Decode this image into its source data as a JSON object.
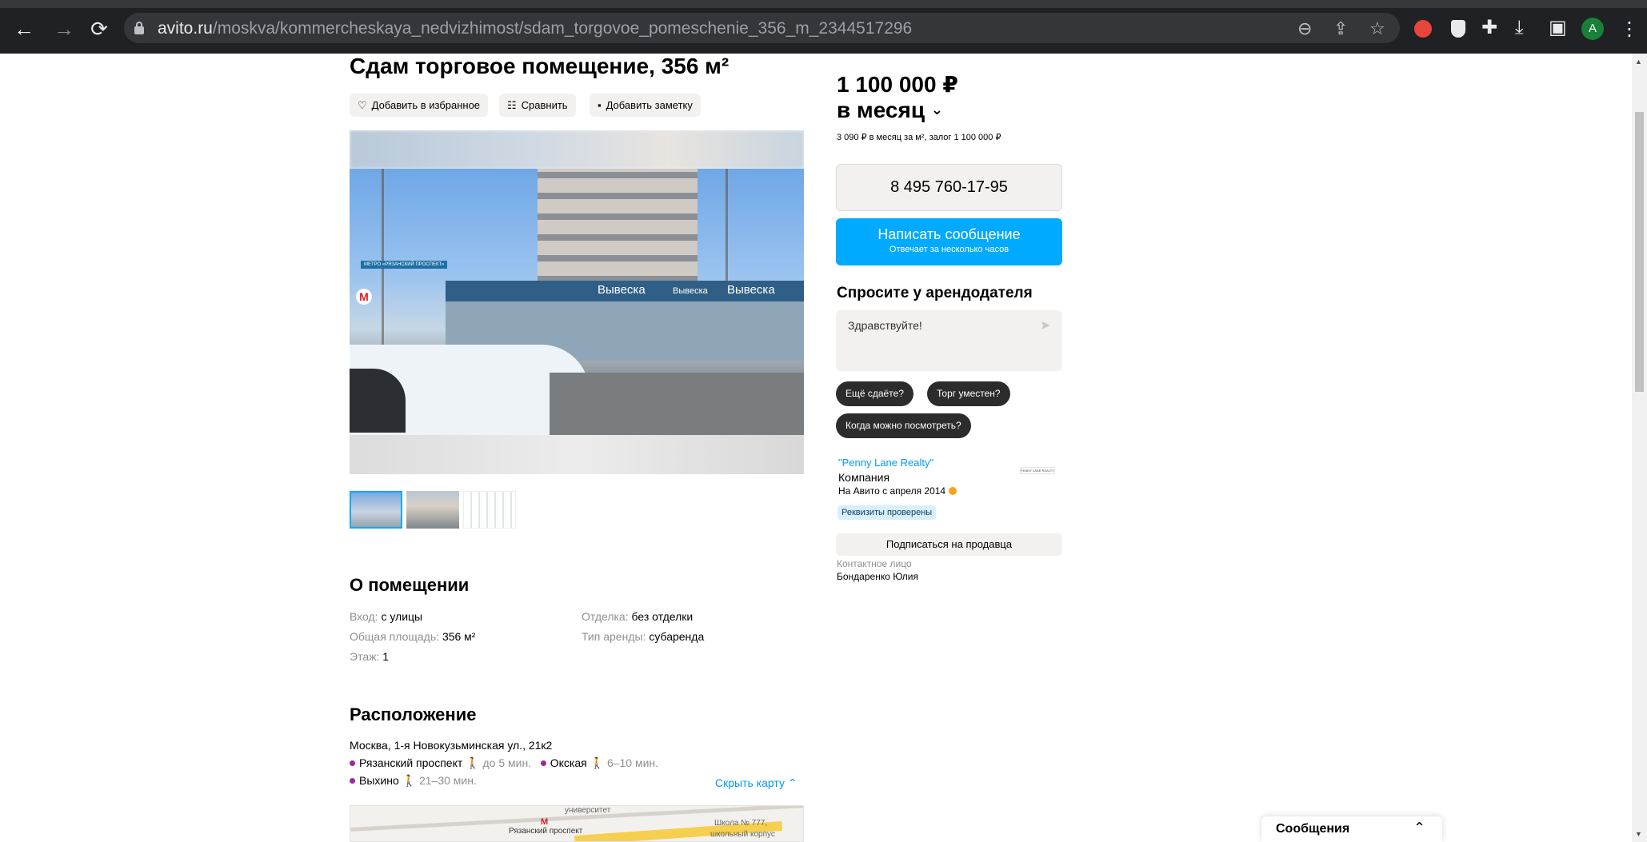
{
  "browser": {
    "url_host": "avito.ru",
    "url_path": "/moskva/kommercheskaya_nedvizhimost/sdam_torgovoe_pomeschenie_356_m_2344517296",
    "profile_initial": "A",
    "back_icon": "←",
    "forward_icon": "→",
    "reload_icon": "⟳",
    "zoom_icon": "⊖",
    "share_icon": "⇪",
    "star_icon": "☆",
    "puzzle_icon": "✚",
    "download_icon": "⤓",
    "sidepanel_icon": "▣",
    "menu_icon": "⋮"
  },
  "listing": {
    "title": "Сдам торговое помещение, 356 м²",
    "actions": {
      "favorite": "Добавить в избранное",
      "compare": "Сравнить",
      "note": "Добавить заметку"
    },
    "photo_labels": {
      "metro": "МЕТРО «РЯЗАНСКИЙ ПРОСПЕКТ»",
      "sign1": "Вывеска",
      "sign2": "Вывеска",
      "sign3": "Вывеска"
    }
  },
  "about": {
    "heading": "О помещении",
    "params": [
      {
        "key": "Вход:",
        "value": "с улицы"
      },
      {
        "key": "Общая площадь:",
        "value": "356 м²"
      },
      {
        "key": "Этаж:",
        "value": "1"
      },
      {
        "key": "Отделка:",
        "value": "без отделки"
      },
      {
        "key": "Тип аренды:",
        "value": "субаренда"
      }
    ]
  },
  "location": {
    "heading": "Расположение",
    "address": "Москва, 1-я Новокузьминская ул., 21к2",
    "metro": [
      {
        "name": "Рязанский проспект",
        "time": "до 5 мин."
      },
      {
        "name": "Окская",
        "time": "6–10 мин."
      },
      {
        "name": "Выхино",
        "time": "21–30 мин."
      }
    ],
    "hide_map": "Скрыть карту",
    "map_labels": {
      "station": "Рязанский проспект",
      "university": "университет",
      "school": "Школа № 777,",
      "school2": "школьный корпус"
    }
  },
  "sidebar": {
    "price": "1 100 000 ₽",
    "period": "в месяц",
    "price_details": "3 090 ₽ в месяц за м², залог 1 100 000 ₽",
    "phone": "8 495 760-17-95",
    "message_button": "Написать сообщение",
    "message_sub": "Отвечает за несколько часов",
    "ask_heading": "Спросите у арендодателя",
    "ask_placeholder": "Здравствуйте!",
    "chips": [
      "Ещё сдаёте?",
      "Торг уместен?",
      "Когда можно посмотреть?"
    ],
    "seller_name": "\"Penny Lane Realty\"",
    "seller_type": "Компания",
    "seller_since": "На Авито с апреля 2014",
    "verified": "Реквизиты проверены",
    "seller_logo": "PENNY LANE REALTY",
    "subscribe": "Подписаться на продавца",
    "contact_label": "Контактное лицо",
    "contact_name": "Бондаренко Юлия"
  },
  "messages_widget": {
    "label": "Сообщения"
  },
  "colors": {
    "accent": "#00aaff",
    "link": "#0099f7",
    "chip": "#2c2c2c",
    "metro_dot": "#9c2a9c"
  }
}
